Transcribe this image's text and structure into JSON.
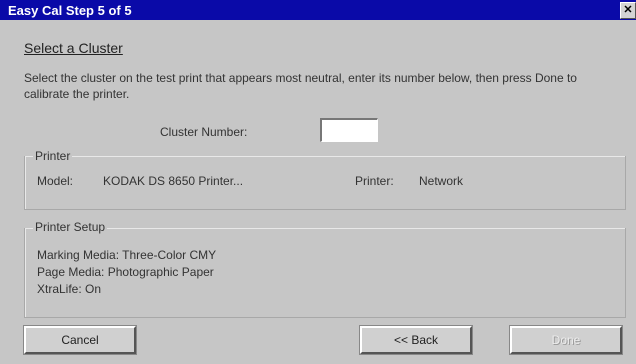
{
  "window": {
    "title": "Easy Cal Step 5 of 5",
    "close_label": "✕"
  },
  "heading": "Select a Cluster",
  "instructions": "Select the cluster on the test print that appears most neutral, enter its number below, then press Done to calibrate the printer.",
  "cluster": {
    "label": "Cluster Number:",
    "value": ""
  },
  "printer_group": {
    "title": "Printer",
    "model_label": "Model:",
    "model_value": "KODAK DS 8650 Printer...",
    "printer_label": "Printer:",
    "printer_value": "Network"
  },
  "setup_group": {
    "title": "Printer Setup",
    "lines": [
      "Marking Media: Three-Color CMY",
      "Page Media: Photographic Paper",
      "XtraLife: On"
    ]
  },
  "buttons": {
    "cancel": "Cancel",
    "back": "<< Back",
    "done": "Done"
  }
}
